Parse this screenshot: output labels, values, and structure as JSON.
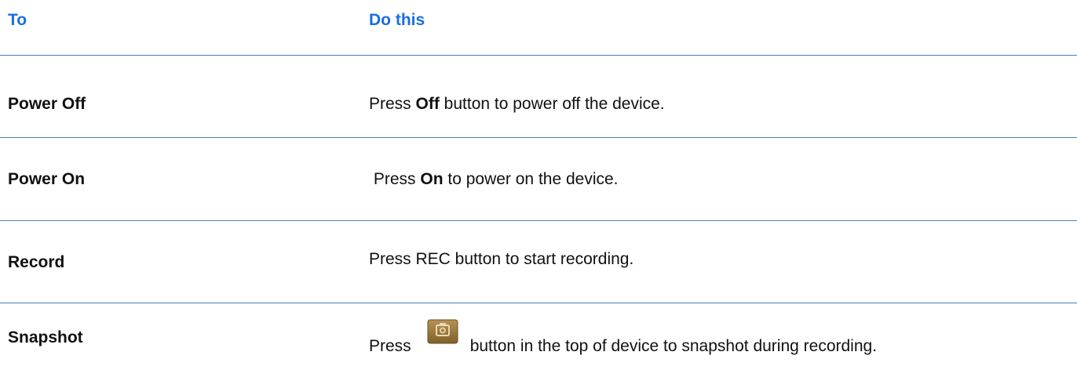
{
  "header": {
    "col_to": "To",
    "col_do": "Do this"
  },
  "rows": [
    {
      "to": "Power Off",
      "do_pre": "Press ",
      "do_bold": "Off",
      "do_post": " button to power off the device."
    },
    {
      "to": "Power On",
      "do_pre": " Press ",
      "do_bold": "On",
      "do_post": " to power on the device."
    },
    {
      "to": "Record",
      "do_text": "Press REC button to start recording."
    },
    {
      "to": "Snapshot",
      "do_pre": "Press",
      "icon": "camera-snapshot-icon",
      "do_post": "button in the top of device to snapshot during recording."
    }
  ],
  "colors": {
    "header_text": "#1a6ee0",
    "rule": "#4a7fb5",
    "icon_bg": "#9a7a3c"
  }
}
